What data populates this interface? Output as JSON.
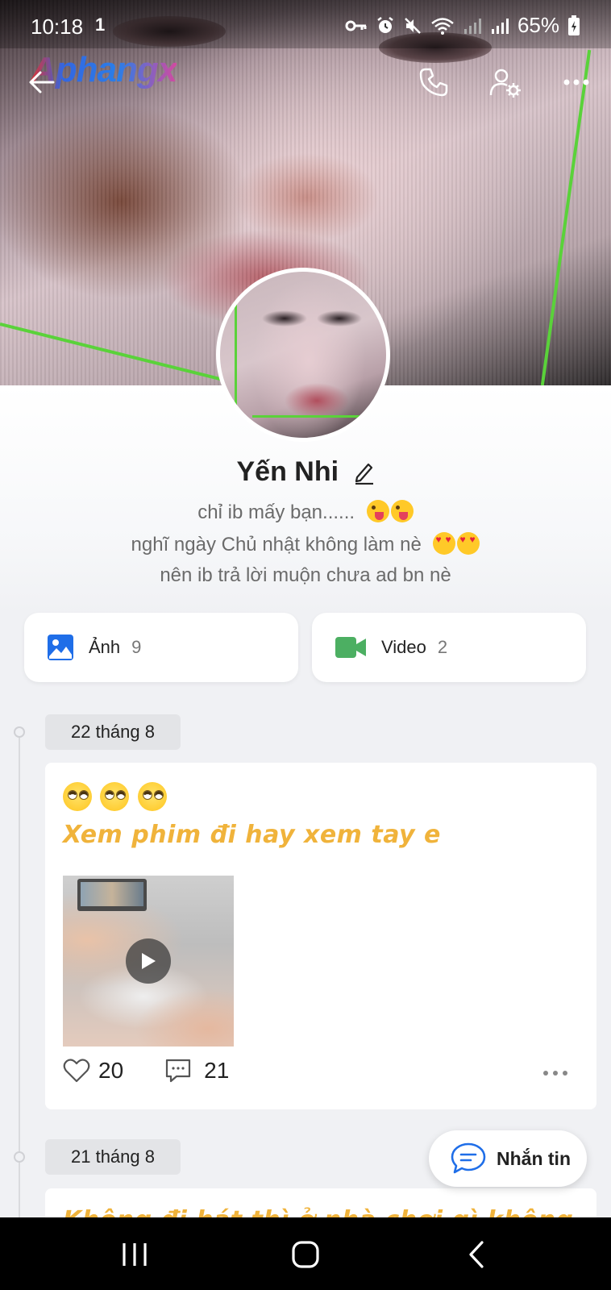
{
  "status_bar": {
    "time": "10:18",
    "notification_indicator": "1",
    "battery": "65%",
    "icons": [
      "key-icon",
      "alarm-icon",
      "mute-icon",
      "wifi-icon",
      "signal-icon",
      "signal-icon",
      "battery-icon"
    ]
  },
  "watermark": "Aphangx",
  "header": {
    "icons": [
      "back-arrow-icon",
      "phone-icon",
      "user-settings-icon",
      "more-icon"
    ]
  },
  "profile": {
    "name": "Yến Nhi",
    "bio_lines": [
      "chỉ ib mấy bạn......",
      "nghĩ ngày Chủ nhật không làm nè",
      "nên ib trả lời muộn chưa ad bn nè"
    ]
  },
  "media": {
    "photos_label": "Ảnh",
    "photos_count": "9",
    "videos_label": "Video",
    "videos_count": "2"
  },
  "timeline": [
    {
      "date": "22 tháng 8",
      "post_text": "Xem phim đi hay xem tay e",
      "likes": "20",
      "comments": "21"
    },
    {
      "date": "21 tháng 8",
      "post_text_partial": "Không đi hát thì ở nhà chơi gì không"
    }
  ],
  "fab": {
    "label": "Nhắn tin"
  },
  "colors": {
    "accent_blue": "#1f6ee8",
    "video_green": "#4caf62",
    "post_text_yellow": "#f0b33b"
  }
}
